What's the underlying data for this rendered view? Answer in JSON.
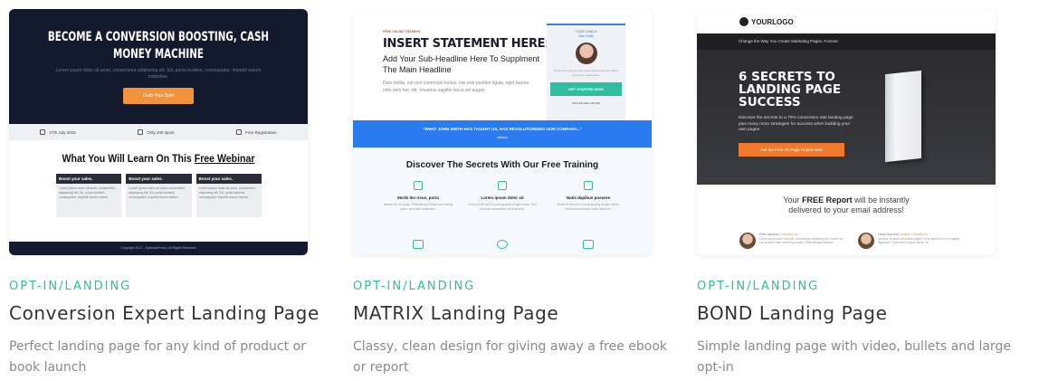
{
  "cards": [
    {
      "category": "OPT-IN/LANDING",
      "title": "Conversion Expert Landing Page",
      "description": "Perfect landing page for any kind of product or book launch",
      "preview": {
        "headline": "BECOME A CONVERSION BOOSTING, CASH MONEY MACHINE",
        "subtext": "Lorem ipsum dolor sit amet, consectetur adipiscing elit. Ed, porta incident, consequatur. Impedit earum molestiae.",
        "cta": "Grab Your Spot",
        "strip": [
          "27th July 2018",
          "Only 100 spots",
          "Free Registration"
        ],
        "learn_prefix": "What You Will Learn On This ",
        "learn_underlined": "Free Webinar",
        "box_heading": "Boost your sales.",
        "box_text": "Lorem ipsum dolor sit amet, consectetur adipiscing elit. Ed, porta incident, consequatur. Impedit earum dolore.",
        "footer": "Copyright 2017 - OptimizePress | All Rights Reserved"
      }
    },
    {
      "category": "OPT-IN/LANDING",
      "title": "MATRIX Landing Page",
      "description": "Classy, clean design for giving away a free ebook or report",
      "preview": {
        "tag": "FREE ONLINE TRAINING",
        "headline": "INSERT STATEMENT HERE:",
        "subheadline": "Add Your Sub-Headline Here To Supplment The Main Headline",
        "paragraph": "Duis mollis, est non commodo luctus, nisi erat porttitor ligula, eget lacinia odio sem nec elit. Vivamus sagittis lacus vel augue.",
        "coach_label": "YOUR COACH",
        "coach_name": "John Smith",
        "coach_text": "Vestibulum id ligula porta felis euismod semper. Etiam porta sem malesuada.",
        "coach_button": "GET STARTED NOW",
        "coach_note": "SPACES ARE LIMITED",
        "quote": "\"WHAT JOHN SMITH HAS TAUGHT US, HAS REVOLUTIONIZED OUR COMPANY...\"",
        "quote_source": "airbnb",
        "section_title": "Discover The Secrets With Our Free Training",
        "features": [
          {
            "title": "Morbi leo risus, porta",
            "text": "Aenean eu leo quam. Pellentesque ornare sem lacinia quam venenatis vestibulum."
          },
          {
            "title": "Lorem ipsum dolor sit",
            "text": "Donec id elit non mi porta gravida at eget metus. Sed posuere consectetur est at lobortis."
          },
          {
            "title": "Natis dapibus posuere",
            "text": "Donec id elit non mi porta gravida at eget metus. Maecenas faucibus mollis interdum."
          }
        ]
      }
    },
    {
      "category": "OPT-IN/LANDING",
      "title": "BOND Landing Page",
      "description": "Simple landing page with video, bullets and large opt-in",
      "preview": {
        "logo": "YOURLOGO",
        "bar_text": "Change the Way You Create Marketing Pages, Forever.",
        "headline": "6 SECRETS TO LANDING PAGE SUCCESS",
        "subtext": "Discover the secrets to a 70% conversion rate landing page plus many more strategies for success when building your own pages",
        "button": "Get the Free 20-Page Report Now",
        "report_pre": "Your ",
        "report_bold": "FREE Report",
        "report_post": " will be instantly delivered to your email address!",
        "testimonials": [
          {
            "name": "Peter Jackson,",
            "company": "Company Inc.",
            "text": "Lorem ipsum dolor sit amet, consectetur adipiscing elit. Donec vel nisi semper enim vehicula posuere. Pellentesque habitant."
          },
          {
            "name": "Laura Guerrero,",
            "company": "Another Company Inc.",
            "text": "Quisque sit amet venenatis sapien. Ut sit amet elit eu ex sagittis dignissim. Fusce lorem ipsum lacus, vel."
          }
        ]
      }
    }
  ]
}
